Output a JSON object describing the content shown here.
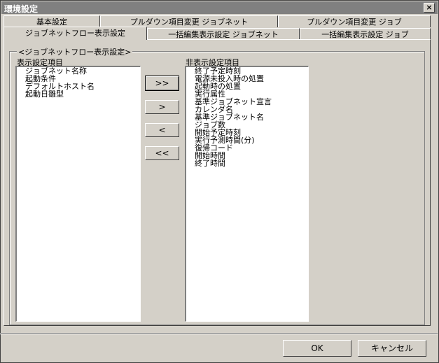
{
  "window": {
    "title": "環境設定",
    "close_glyph": "×"
  },
  "tabs_back": [
    "基本設定",
    "プルダウン項目変更 ジョブネット",
    "プルダウン項目変更 ジョブ"
  ],
  "tabs_front": [
    "ジョブネットフロー表示設定",
    "一括編集表示設定 ジョブネット",
    "一括編集表示設定 ジョブ"
  ],
  "group": {
    "label": "<ジョブネットフロー表示設定>"
  },
  "display_list": {
    "label": "表示設定項目",
    "items": [
      "ジョブネット名称",
      "起動条件",
      "デフォルトホスト名",
      "起動日雛型"
    ]
  },
  "hidden_list": {
    "label": "非表示設定項目",
    "items": [
      "終了予定時刻",
      "電源未投入時の処置",
      "起動時の処置",
      "実行属性",
      "基準ジョブネット宣言",
      "カレンダ名",
      "基準ジョブネット名",
      "ジョブ数",
      "開始予定時刻",
      "実行予測時間(分)",
      "復帰コード",
      "開始時間",
      "終了時間"
    ]
  },
  "move_buttons": {
    "add_all": ">>",
    "add": ">",
    "remove": "<",
    "remove_all": "<<"
  },
  "footer": {
    "ok": "OK",
    "cancel": "キャンセル"
  }
}
